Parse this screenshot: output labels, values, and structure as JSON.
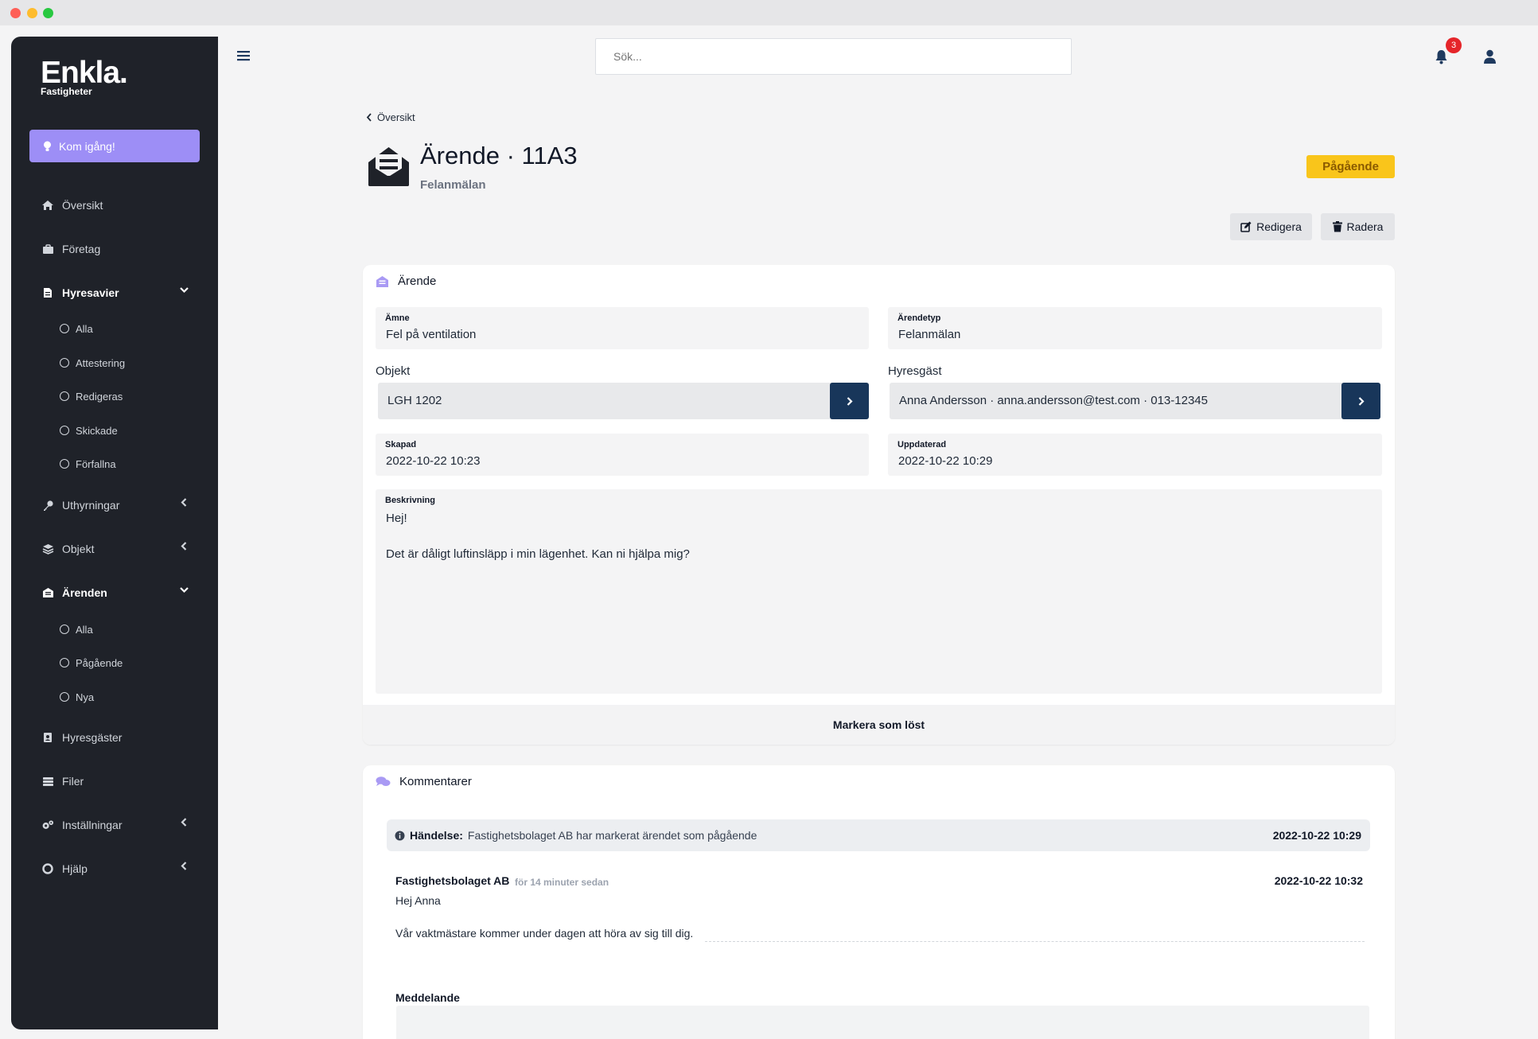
{
  "brand": {
    "name": "Enkla.",
    "subtitle": "Fastigheter"
  },
  "sidebar": {
    "cta_label": "Kom igång!",
    "items": [
      {
        "label": "Översikt"
      },
      {
        "label": "Företag"
      },
      {
        "label": "Hyresavier",
        "children": [
          "Alla",
          "Attestering",
          "Redigeras",
          "Skickade",
          "Förfallna"
        ]
      },
      {
        "label": "Uthyrningar"
      },
      {
        "label": "Objekt"
      },
      {
        "label": "Ärenden",
        "children": [
          "Alla",
          "Pågående",
          "Nya"
        ]
      },
      {
        "label": "Hyresgäster"
      },
      {
        "label": "Filer"
      },
      {
        "label": "Inställningar"
      },
      {
        "label": "Hjälp"
      }
    ]
  },
  "topbar": {
    "search_placeholder": "Sök...",
    "notification_count": "3"
  },
  "page": {
    "breadcrumb": "Översikt",
    "title": "Ärende · 11A3",
    "subtitle": "Felanmälan",
    "status": "Pågående",
    "edit_label": "Redigera",
    "delete_label": "Radera"
  },
  "case_card": {
    "title": "Ärende",
    "subject_label": "Ämne",
    "subject": "Fel på ventilation",
    "type_label": "Ärendetyp",
    "type": "Felanmälan",
    "object_label": "Objekt",
    "object": "LGH 1202",
    "tenant_label": "Hyresgäst",
    "tenant": "Anna Andersson · anna.andersson@test.com · 013-12345",
    "created_label": "Skapad",
    "created": "2022-10-22 10:23",
    "updated_label": "Uppdaterad",
    "updated": "2022-10-22 10:29",
    "description_label": "Beskrivning",
    "description_line1": "Hej!",
    "description_line2": "Det är dåligt luftinsläpp i min lägenhet. Kan ni hjälpa mig?",
    "resolve_label": "Markera som löst"
  },
  "comments_card": {
    "title": "Kommentarer",
    "event_label": "Händelse:",
    "event_text": "Fastighetsbolaget AB har markerat ärendet som pågående",
    "event_time": "2022-10-22 10:29",
    "comment_author": "Fastighetsbolaget AB",
    "comment_ago": "för 14 minuter sedan",
    "comment_time": "2022-10-22 10:32",
    "comment_line1": "Hej Anna",
    "comment_line2": "Vår vaktmästare kommer under dagen att höra av sig till dig.",
    "message_label": "Meddelande"
  },
  "colors": {
    "sidebar_bg": "#1f2229",
    "accent": "#9d8ef6",
    "status_bg": "#f9c51b",
    "action_bg": "#18365a"
  }
}
